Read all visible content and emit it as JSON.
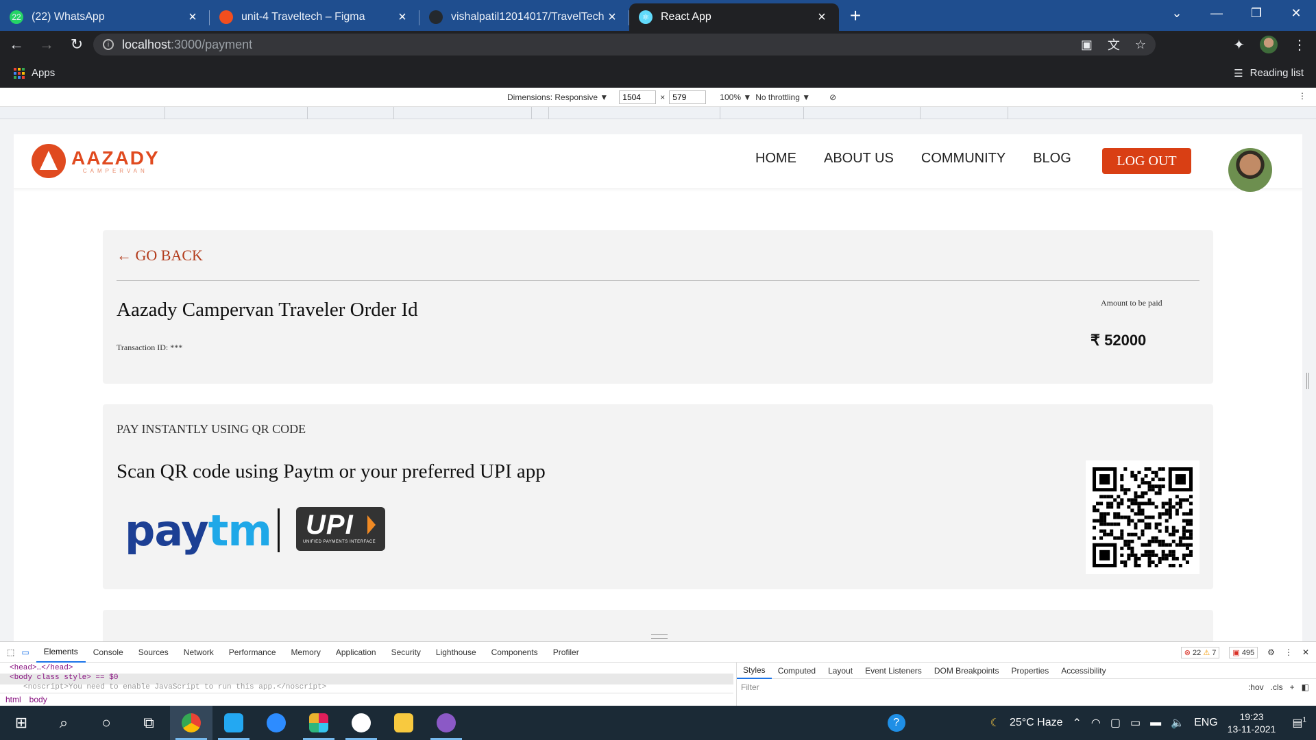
{
  "browser": {
    "tabs": [
      {
        "title": "(22) WhatsApp",
        "icon": "whatsapp-icon",
        "color": "#25d366",
        "glyph": "22"
      },
      {
        "title": "unit-4 Traveltech – Figma",
        "icon": "figma-icon",
        "color": "#f24e1e",
        "glyph": ""
      },
      {
        "title": "vishalpatil12014017/TravelTech",
        "icon": "github-icon",
        "color": "#24292e",
        "glyph": ""
      },
      {
        "title": "React App",
        "icon": "react-icon",
        "color": "#61dafb",
        "glyph": "⚛"
      }
    ],
    "active_tab_index": 3,
    "url_host": "localhost",
    "url_path": ":3000/payment",
    "bookmarks_apps": "Apps",
    "reading_list": "Reading list"
  },
  "device_toolbar": {
    "dimensions_label": "Dimensions: Responsive ▼",
    "width": "1504",
    "height": "579",
    "zoom": "100% ▼",
    "throttling": "No throttling ▼"
  },
  "site": {
    "brand": "AAZADY",
    "brand_sub": "CAMPERVAN",
    "brand_color": "#e04a1f",
    "nav": [
      "HOME",
      "ABOUT US",
      "COMMUNITY",
      "BLOG"
    ],
    "logout_label": "LOG OUT"
  },
  "order": {
    "go_back": "← GO BACK",
    "title": "Aazady Campervan Traveler Order Id",
    "transaction": "Transaction ID: ***",
    "amount_label": "Amount to be paid",
    "amount": "₹ 52000"
  },
  "qr": {
    "heading": "PAY INSTANTLY USING QR CODE",
    "subheading": "Scan QR code using Paytm or your preferred UPI app",
    "paytm_pay": "pay",
    "paytm_tm": "tm",
    "upi_text": "UPI",
    "upi_small": "UNIFIED PAYMENTS INTERFACE"
  },
  "devtools": {
    "tabs": [
      "Elements",
      "Console",
      "Sources",
      "Network",
      "Performance",
      "Memory",
      "Application",
      "Security",
      "Lighthouse",
      "Components",
      "Profiler"
    ],
    "errors": "22",
    "warnings": "7",
    "issues": "495",
    "dom_line1": "<head>…</head>",
    "dom_line2": "<body class style> == $0",
    "dom_line3": "<noscript>You need to enable JavaScript to run this app.</noscript>",
    "crumbs": [
      "html",
      "body"
    ],
    "style_tabs": [
      "Styles",
      "Computed",
      "Layout",
      "Event Listeners",
      "DOM Breakpoints",
      "Properties",
      "Accessibility"
    ],
    "filter_placeholder": "Filter",
    "hov": ":hov",
    "cls": ".cls"
  },
  "taskbar": {
    "weather": "25°C  Haze",
    "lang": "ENG",
    "time": "19:23",
    "date": "13-11-2021",
    "notifications": "1"
  }
}
